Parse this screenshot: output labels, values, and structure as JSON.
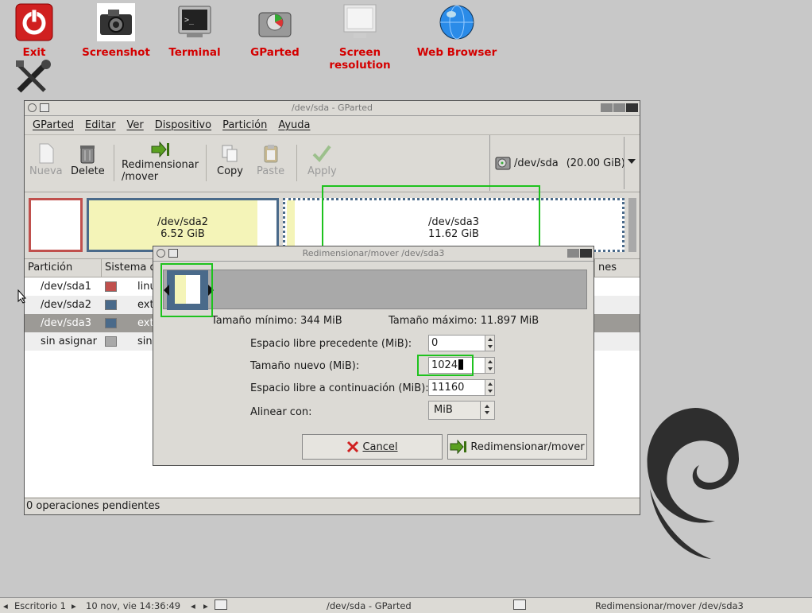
{
  "desktop": {
    "icons": [
      {
        "label": "Exit"
      },
      {
        "label": "Screenshot"
      },
      {
        "label": "Terminal"
      },
      {
        "label": "GParted"
      },
      {
        "label": "Screen resolution"
      },
      {
        "label": "Web Browser"
      }
    ]
  },
  "main_window": {
    "title": "/dev/sda - GParted",
    "menu": [
      "GParted",
      "Editar",
      "Ver",
      "Dispositivo",
      "Partición",
      "Ayuda"
    ],
    "toolbar": {
      "new": "Nueva",
      "delete": "Delete",
      "resize_line1": "Redimensionar",
      "resize_line2": "/mover",
      "copy": "Copy",
      "paste": "Paste",
      "apply": "Apply"
    },
    "device": {
      "name": "/dev/sda",
      "size": "(20.00 GiB)"
    },
    "partitions_map": [
      {
        "name": "/dev/sda2",
        "size": "6.52 GiB"
      },
      {
        "name": "/dev/sda3",
        "size": "11.62 GiB"
      }
    ],
    "columns": {
      "partition": "Partición",
      "filesystem": "Sistema d",
      "flags": "nes"
    },
    "rows": [
      {
        "partition": "/dev/sda1",
        "fs": "linu",
        "color": "#c0504d"
      },
      {
        "partition": "/dev/sda2",
        "fs": "ext",
        "color": "#4a6a8a"
      },
      {
        "partition": "/dev/sda3",
        "fs": "ext",
        "color": "#4a6a8a"
      },
      {
        "partition": "sin asignar",
        "fs": "sin",
        "color": "#a9a9a9"
      }
    ],
    "status": "0 operaciones pendientes"
  },
  "dialog": {
    "title": "Redimensionar/mover /dev/sda3",
    "min_size": "Tamaño mínimo: 344 MiB",
    "max_size": "Tamaño máximo: 11.897 MiB",
    "free_before_label": "Espacio libre precedente (MiB):",
    "free_before_value": "0",
    "new_size_label": "Tamaño nuevo (MiB):",
    "new_size_value": "1024",
    "free_after_label": "Espacio libre a continuación (MiB):",
    "free_after_value": "11160",
    "align_label": "Alinear con:",
    "align_value": "MiB",
    "cancel": "Cancel",
    "resize": "Redimensionar/mover"
  },
  "taskbar": {
    "desktop": "Escritorio 1",
    "datetime": "10 nov, vie 14:36:49",
    "task1": "/dev/sda - GParted",
    "task2": "Redimensionar/mover /dev/sda3"
  },
  "colors": {
    "highlight": "#1ec21e",
    "desktop_label": "#d40000"
  }
}
